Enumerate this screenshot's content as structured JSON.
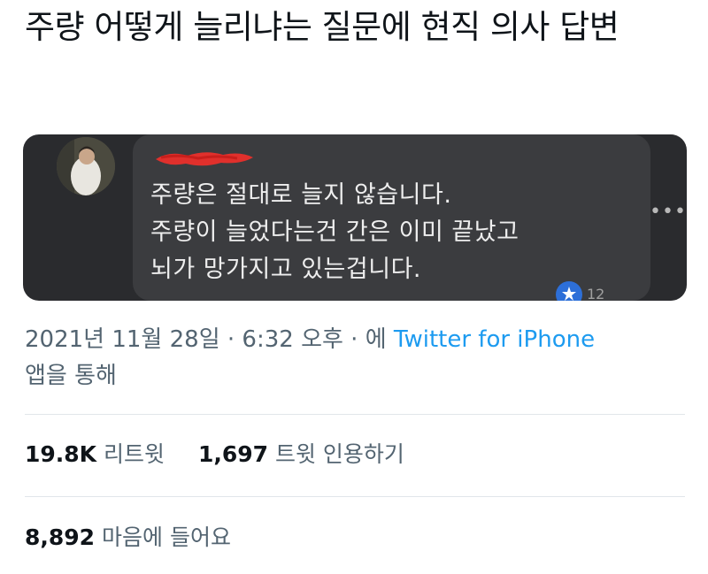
{
  "tweet": {
    "text": "주량 어떻게 늘리냐는 질문에 현직 의사 답변"
  },
  "media": {
    "comment_lines": [
      "주량은 절대로 늘지 않습니다.",
      "주량이 늘었다는건 간은 이미 끝났고",
      "뇌가 망가지고 있는겁니다."
    ],
    "reaction_count": "12",
    "colors": {
      "card_bg": "#2a2b2e",
      "bubble_bg": "#3b3c3f",
      "redaction": "#e0302c",
      "reaction": "#2d6fd8"
    }
  },
  "meta": {
    "timestamp": "2021년 11월 28일 · 6:32 오후 · 에",
    "source": "Twitter for iPhone",
    "source_suffix": "앱을 통해",
    "colors": {
      "text": "#536471",
      "link": "#1d9bf0"
    }
  },
  "stats": {
    "retweets_count": "19.8K",
    "retweets_label": "리트윗",
    "quotes_count": "1,697",
    "quotes_label": "트윗 인용하기",
    "likes_count": "8,892",
    "likes_label": "마음에 들어요"
  },
  "icons": [
    "more-icon",
    "avatar",
    "reaction-icon"
  ]
}
